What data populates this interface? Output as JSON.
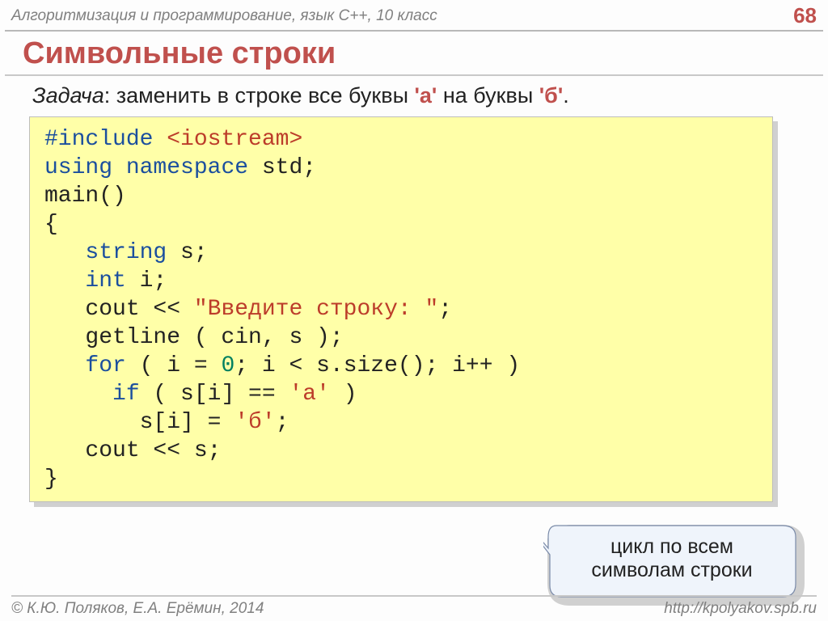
{
  "header": {
    "course": "Алгоритмизация и программирование, язык C++, 10 класс",
    "page": "68"
  },
  "title": "Символьные строки",
  "task": {
    "label": "Задача",
    "before": ": заменить в строке все буквы ",
    "lit1": "'а'",
    "mid": " на буквы ",
    "lit2": "'б'",
    "after": "."
  },
  "code": {
    "l1_include": "#include ",
    "l1_iostream": "<iostream>",
    "l2_using": "using ",
    "l2_ns": "namespace ",
    "l2_std": "std;",
    "l3": "main()",
    "l4": "{",
    "l5_ind": "   ",
    "l5_string": "string",
    "l5_s": " s;",
    "l6_ind": "   ",
    "l6_int": "int",
    "l6_i": " i;",
    "l7": "   cout << ",
    "l7_str": "\"Введите строку: \"",
    "l7_end": ";",
    "l8": "   getline ( cin, s );",
    "l9_ind": "   ",
    "l9_for": "for",
    "l9_a": " ( i = ",
    "l9_zero": "0",
    "l9_b": "; i < s.size(); i++ )",
    "l10_ind": "     ",
    "l10_if": "if",
    "l10_a": " ( s[i] == ",
    "l10_ch": "'а'",
    "l10_b": " )",
    "l11_a": "       s[i] = ",
    "l11_ch": "'б'",
    "l11_b": ";",
    "l12": "   cout << s;",
    "l13": "}"
  },
  "callout": {
    "line1": "цикл по всем",
    "line2": "символам строки"
  },
  "footer": {
    "copyright": "© К.Ю. Поляков, Е.А. Ерёмин, 2014",
    "url": "http://kpolyakov.spb.ru"
  }
}
